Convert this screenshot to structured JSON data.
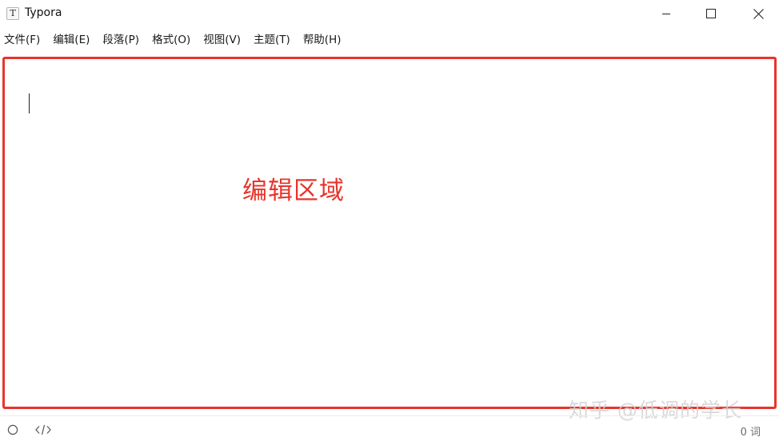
{
  "window": {
    "app_icon_letter": "T",
    "title": "Typora",
    "controls": {
      "minimize": "minimize-icon",
      "maximize": "maximize-icon",
      "close": "close-icon"
    }
  },
  "menu": {
    "items": [
      {
        "label": "文件(F)"
      },
      {
        "label": "编辑(E)"
      },
      {
        "label": "段落(P)"
      },
      {
        "label": "格式(O)"
      },
      {
        "label": "视图(V)"
      },
      {
        "label": "主题(T)"
      },
      {
        "label": "帮助(H)"
      }
    ]
  },
  "editor": {
    "annotation_label": "编辑区域",
    "highlight_color": "#e8342c"
  },
  "watermark": {
    "text": "知乎 @低调的学长"
  },
  "status": {
    "sidebar_icon": "circle-outline-icon",
    "source_icon": "code-brackets-icon",
    "word_count": "0 词"
  }
}
